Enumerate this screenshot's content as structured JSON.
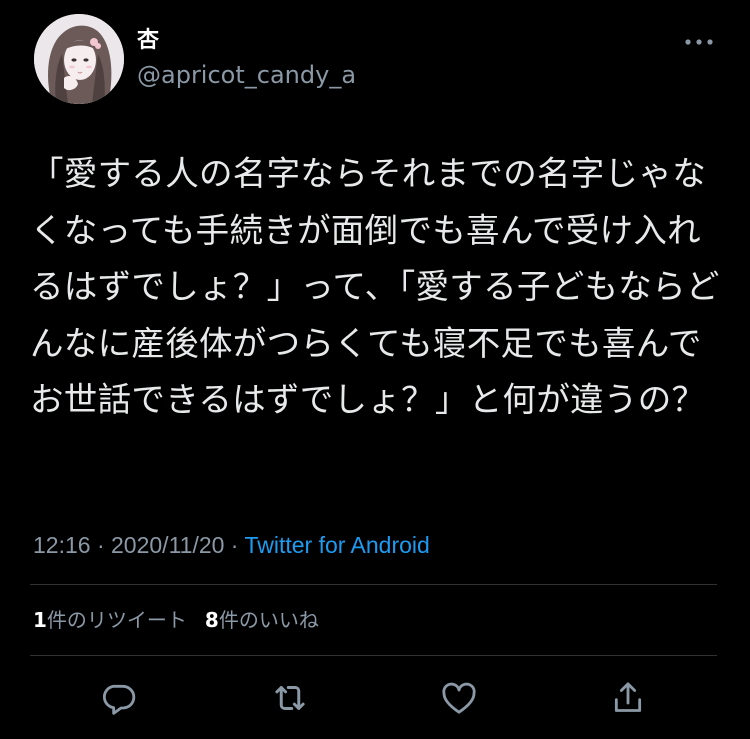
{
  "user": {
    "display_name": "杏",
    "handle": "@apricot_candy_a"
  },
  "tweet": {
    "text": "「愛する人の名字ならそれまでの名字じゃなくなっても手続きが面倒でも喜んで受け入れるはずでしょ？」って、「愛する子どもならどんなに産後体がつらくても寝不足でも喜んでお世話できるはずでしょ？」と何が違うの？",
    "time": "12:16",
    "separator": " · ",
    "date": "2020/11/20",
    "source": "Twitter for Android"
  },
  "stats": {
    "retweet_count": "1",
    "retweet_label": "件のリツイート",
    "like_count": "8",
    "like_label": "件のいいね"
  },
  "colors": {
    "background": "#000000",
    "text": "#e7e9ea",
    "secondary": "#8b98a5",
    "accent": "#1d9bf0",
    "divider": "#2f3336"
  },
  "icons": {
    "more": "more-horizontal-icon",
    "reply": "reply-icon",
    "retweet": "retweet-icon",
    "like": "heart-icon",
    "share": "share-icon"
  }
}
